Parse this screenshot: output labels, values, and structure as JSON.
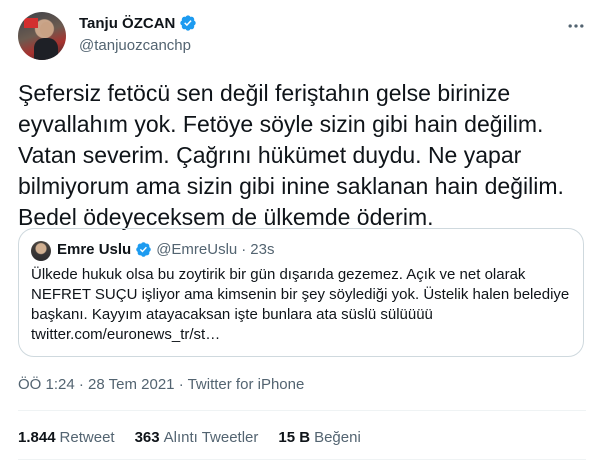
{
  "author": {
    "display_name": "Tanju ÖZCAN",
    "handle": "@tanjuozcanchp"
  },
  "icons": {
    "verified": "verified-badge-icon",
    "more": "more-options-icon"
  },
  "colors": {
    "verified": "#1d9bf0",
    "secondary_text": "#536471",
    "border": "#cfd9de"
  },
  "tweet": {
    "text": "Şefersiz fetöcü sen değil feriştahın gelse birinize\neyvallahım yok. Fetöye söyle sizin gibi hain değilim.\nVatan severim. Çağrını hükümet duydu. Ne yapar\nbilmiyorum ama sizin gibi inine saklanan hain değilim.\nBedel ödeyeceksem de ülkemde öderim."
  },
  "quote": {
    "display_name": "Emre Uslu",
    "handle": "@EmreUslu",
    "separator": "·",
    "time": "23s",
    "text": "Ülkede hukuk olsa bu zoytirik bir gün dışarıda gezemez. Açık ve net olarak\nNEFRET SUÇU işliyor ama kimsenin bir şey söylediği yok. Üstelik halen belediye\nbaşkanı. Kayyım atayacaksan işte bunlara ata süslü sülüüüü\ntwitter.com/euronews_tr/st…"
  },
  "meta": {
    "time": "ÖÖ 1:24",
    "separator1": "·",
    "date": "28 Tem 2021",
    "separator2": "·",
    "source": "Twitter for iPhone"
  },
  "stats": {
    "retweets_count": "1.844",
    "retweets_label": "Retweet",
    "quotes_count": "363",
    "quotes_label": "Alıntı Tweetler",
    "likes_count": "15 B",
    "likes_label": "Beğeni"
  }
}
